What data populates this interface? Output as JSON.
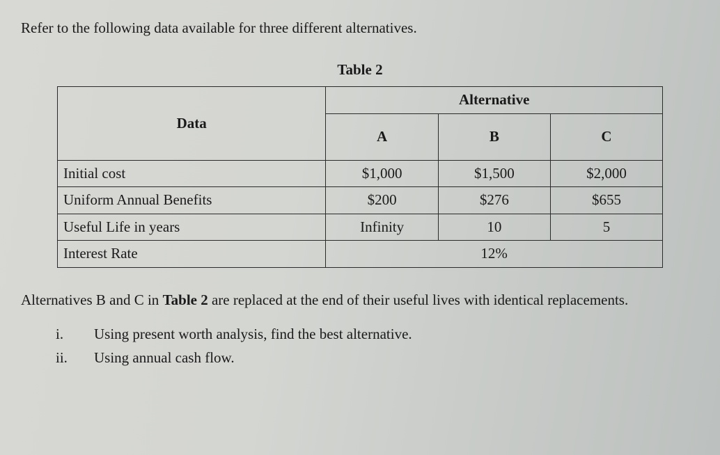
{
  "intro": "Refer to the following data available for three different alternatives.",
  "table_title": "Table 2",
  "headers": {
    "data": "Data",
    "alternative": "Alternative",
    "A": "A",
    "B": "B",
    "C": "C"
  },
  "rows": {
    "initial_cost": {
      "label": "Initial cost",
      "A": "$1,000",
      "B": "$1,500",
      "C": "$2,000"
    },
    "uab": {
      "label": "Uniform Annual Benefits",
      "A": "$200",
      "B": "$276",
      "C": "$655"
    },
    "life": {
      "label": "Useful Life in years",
      "A": "Infinity",
      "B": "10",
      "C": "5"
    },
    "rate": {
      "label": "Interest Rate",
      "value": "12%"
    }
  },
  "note_part1": "Alternatives B and C in ",
  "note_bold": "Table 2",
  "note_part2": " are replaced at the end of their useful lives with identical replacements.",
  "questions": {
    "i_num": "i.",
    "i_text": "Using present worth analysis, find the best alternative.",
    "ii_num": "ii.",
    "ii_text": "Using annual cash flow."
  },
  "chart_data": {
    "type": "table",
    "title": "Table 2",
    "columns": [
      "Data",
      "A",
      "B",
      "C"
    ],
    "rows": [
      [
        "Initial cost",
        "$1,000",
        "$1,500",
        "$2,000"
      ],
      [
        "Uniform Annual Benefits",
        "$200",
        "$276",
        "$655"
      ],
      [
        "Useful Life in years",
        "Infinity",
        "10",
        "5"
      ],
      [
        "Interest Rate",
        "12%",
        "12%",
        "12%"
      ]
    ]
  }
}
